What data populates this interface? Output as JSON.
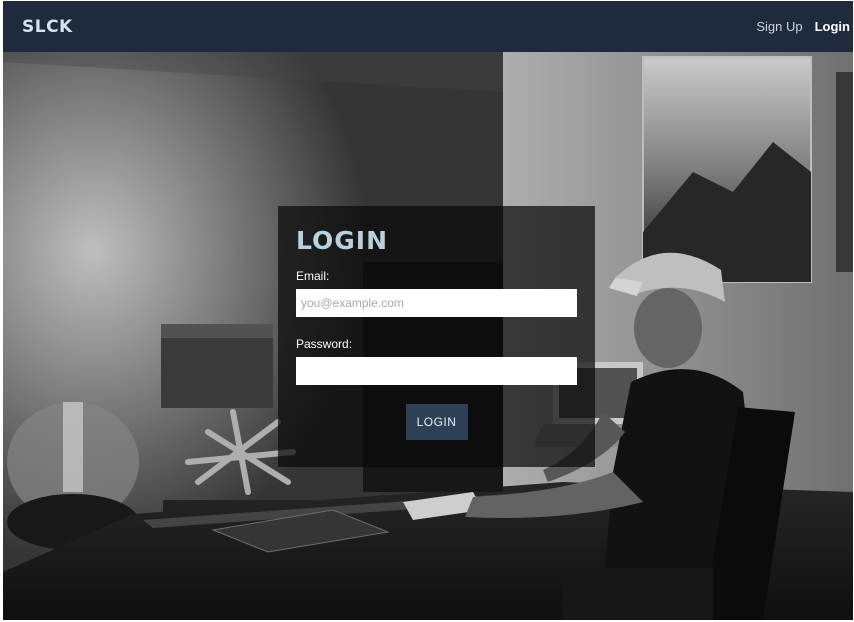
{
  "navbar": {
    "brand": "SLCK",
    "links": [
      {
        "label": "Sign Up"
      },
      {
        "label": "Login"
      }
    ]
  },
  "login": {
    "title": "LOGIN",
    "email_label": "Email:",
    "email_placeholder": "you@example.com",
    "email_value": "",
    "password_label": "Password:",
    "password_value": "",
    "submit_label": "LOGIN"
  },
  "background": {
    "description_icon": "workspace-photo",
    "tone": "grayscale"
  },
  "colors": {
    "navbar": "#1f2b3c",
    "title": "#b9d1df",
    "button": "#2d4156"
  }
}
